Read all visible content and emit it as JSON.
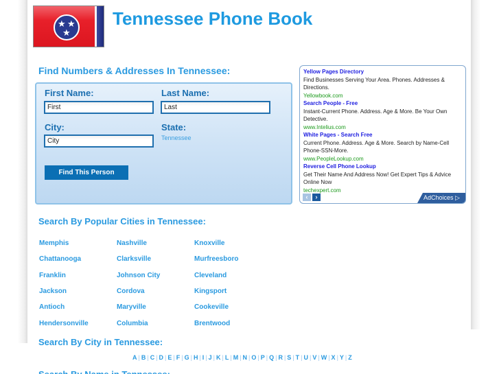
{
  "header": {
    "title": "Tennessee Phone Book",
    "flag_icon": "tennessee-flag"
  },
  "search": {
    "heading": "Find Numbers & Addresses In Tennessee:",
    "first_name_label": "First Name:",
    "first_name_value": "First",
    "last_name_label": "Last Name:",
    "last_name_value": "Last",
    "city_label": "City:",
    "city_value": "City",
    "state_label": "State:",
    "state_value": "Tennessee",
    "button_label": "Find This Person"
  },
  "ads": {
    "items": [
      {
        "title": "Yellow Pages Directory",
        "desc": "Find Businesses Serving Your Area. Phones. Addresses & Directions.",
        "url": "Yellowbook.com"
      },
      {
        "title": "Search People - Free",
        "desc": "Instant-Current Phone. Address. Age & More. Be Your Own Detective.",
        "url": "www.Intelius.com"
      },
      {
        "title": "White Pages - Search Free",
        "desc": "Current Phone. Address. Age & More. Search by Name-Cell Phone-SSN-More.",
        "url": "www.PeopleLookup.com"
      },
      {
        "title": "Reverse Cell Phone Lookup",
        "desc": "Get Their Name And Address Now! Get Expert Tips & Advice Online Now",
        "url": "techexpert.com"
      }
    ],
    "prev_icon": "‹",
    "next_icon": "›",
    "adchoices_label": "AdChoices ▷"
  },
  "popular": {
    "heading": "Search By Popular Cities in Tennessee:",
    "cities": [
      [
        "Memphis",
        "Nashville",
        "Knoxville"
      ],
      [
        "Chattanooga",
        "Clarksville",
        "Murfreesboro"
      ],
      [
        "Franklin",
        "Johnson City",
        "Cleveland"
      ],
      [
        "Jackson",
        "Cordova",
        "Kingsport"
      ],
      [
        "Antioch",
        "Maryville",
        "Cookeville"
      ],
      [
        "Hendersonville",
        "Columbia",
        "Brentwood"
      ]
    ]
  },
  "by_city": {
    "heading": "Search By City in Tennessee:",
    "letters": [
      "A",
      "B",
      "C",
      "D",
      "E",
      "F",
      "G",
      "H",
      "I",
      "J",
      "K",
      "L",
      "M",
      "N",
      "O",
      "P",
      "Q",
      "R",
      "S",
      "T",
      "U",
      "V",
      "W",
      "X",
      "Y",
      "Z"
    ]
  },
  "by_name": {
    "heading": "Search By Name in Tennessee:"
  }
}
